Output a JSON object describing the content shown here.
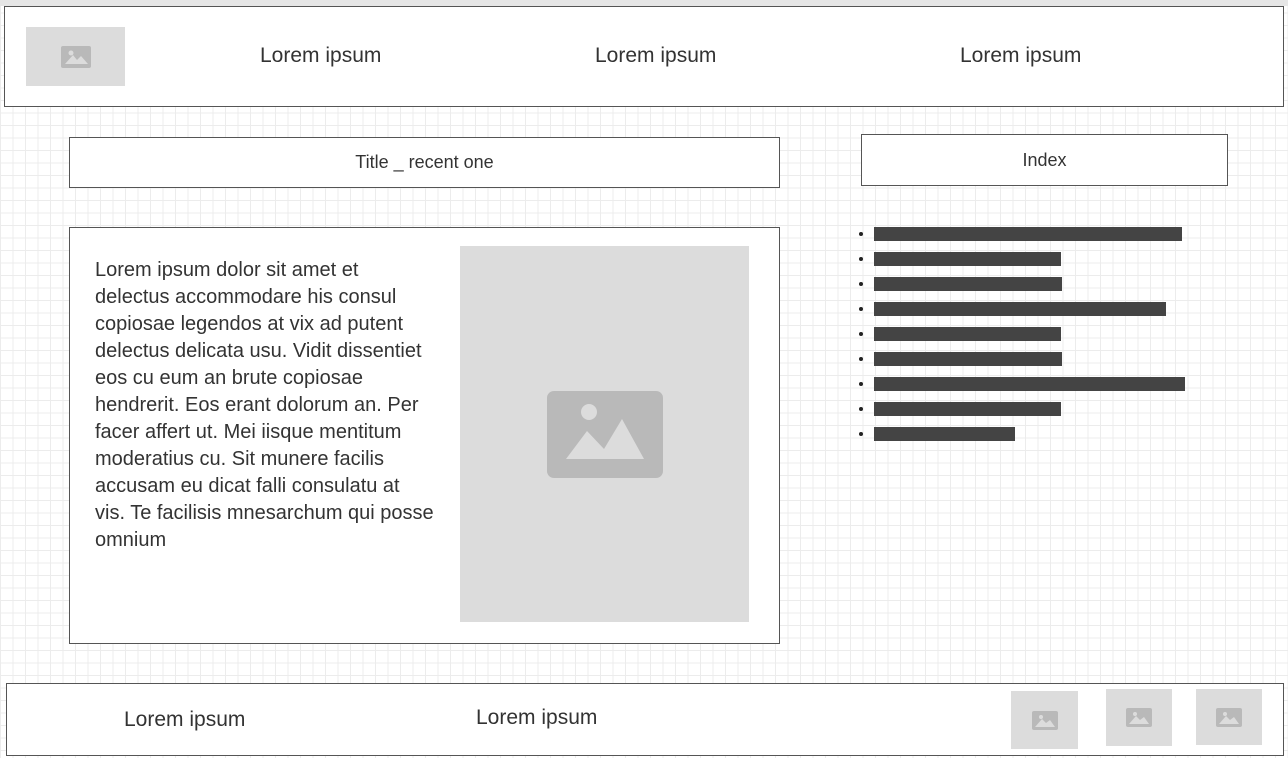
{
  "header": {
    "logo_icon": "image-icon",
    "nav": [
      "Lorem ipsum",
      "Lorem ipsum",
      "Lorem ipsum"
    ]
  },
  "main": {
    "title": "Title _ recent one",
    "body": "Lorem ipsum dolor sit amet et delectus accommodare his consul copiosae legendos at vix ad putent delectus delicata usu. Vidit dissentiet eos cu eum an brute copiosae hendrerit. Eos erant dolorum an. Per facer affert ut. Mei iisque mentitum moderatius cu. Sit munere facilis accusam eu dicat falli consulatu at vis. Te facilisis mnesarchum qui posse omnium",
    "image_icon": "image-icon"
  },
  "sidebar": {
    "title": "Index",
    "items_count": 9
  },
  "footer": {
    "links": [
      "Lorem ipsum",
      "Lorem ipsum"
    ],
    "icons": [
      "image-icon",
      "image-icon",
      "image-icon"
    ]
  },
  "colors": {
    "placeholder": "#dcdcdc",
    "placeholder_icon": "#b9b9b9",
    "bar": "#444444",
    "border": "#555555"
  }
}
